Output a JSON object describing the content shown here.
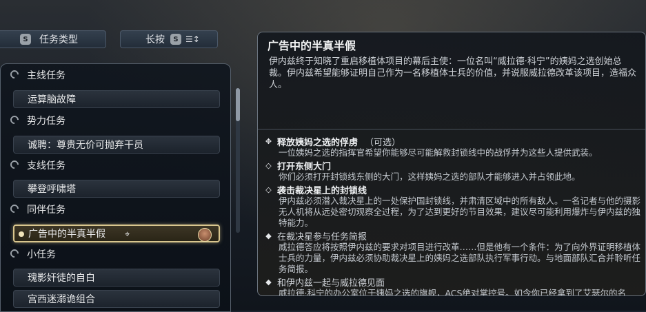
{
  "toolbar": {
    "filter_key": "S",
    "filter_label": "任务类型",
    "hold_label": "长按",
    "hold_key": "S",
    "sort_icon": "sort-icon"
  },
  "quest_list": {
    "groups": [
      {
        "category": "主线任务",
        "items": [
          "运算脑故障"
        ]
      },
      {
        "category": "势力任务",
        "items": [
          "诚聘：尊贵无价可抛弃干员"
        ]
      },
      {
        "category": "支线任务",
        "items": [
          "攀登呼啸塔"
        ]
      },
      {
        "category": "同伴任务",
        "items": [
          "广告中的半真半假"
        ]
      },
      {
        "category": "小任务",
        "items": [
          "瑰影奸徒的自白",
          "宫西迷溺诡组合"
        ]
      }
    ],
    "selected": "广告中的半真半假"
  },
  "detail": {
    "title": "广告中的半真半假",
    "description": "伊内兹终于知晓了重启移植体项目的幕后主使：一位名叫“威拉德·科宁”的姨妈之选创始总裁。伊内兹希望能够证明自己作为一名移植体士兵的价值，并说服威拉德改革该项目，造福众人。",
    "objectives": [
      {
        "title": "释放姨妈之选的俘虏",
        "optional": "（可选）",
        "text": "一位姨妈之选的指挥官希望你能够尽可能解救封锁线中的战俘并为这些人提供武装。"
      },
      {
        "title": "打开东侧大门",
        "optional": "",
        "text": "你们必须打开封锁线东侧的大门，这样姨妈之选的部队才能够进入并占领此地。"
      },
      {
        "title": "袭击裁决星上的封锁线",
        "optional": "",
        "text": "伊内兹必须潜入裁决星上的一处保护国封锁线，并肃清区域中的所有敌人。一名记者与他的摄影无人机将从远处密切观察全过程，为了达到更好的节目效果，建议尽可能利用爆炸与伊内兹的独特能力。"
      },
      {
        "title": "在裁决星参与任务简报",
        "optional": "",
        "text": "威拉德答应将按照伊内兹的要求对项目进行改革……但是他有一个条件：为了向外界证明移植体士兵的力量，伊内兹必须协助裁决星上的姨妈之选部队执行军事行动。与地面部队汇合并聆听任务简报。"
      },
      {
        "title": "和伊内兹一起与威拉德见面",
        "optional": "",
        "text": "威拉德·科宁的办公室位于姨妈之选的旗舰，ACS绝对掌控号。如今你已经拿到了艾瑟尔的名片，而且还有伊内兹随同，要和威拉德见面应该不难。"
      }
    ]
  }
}
